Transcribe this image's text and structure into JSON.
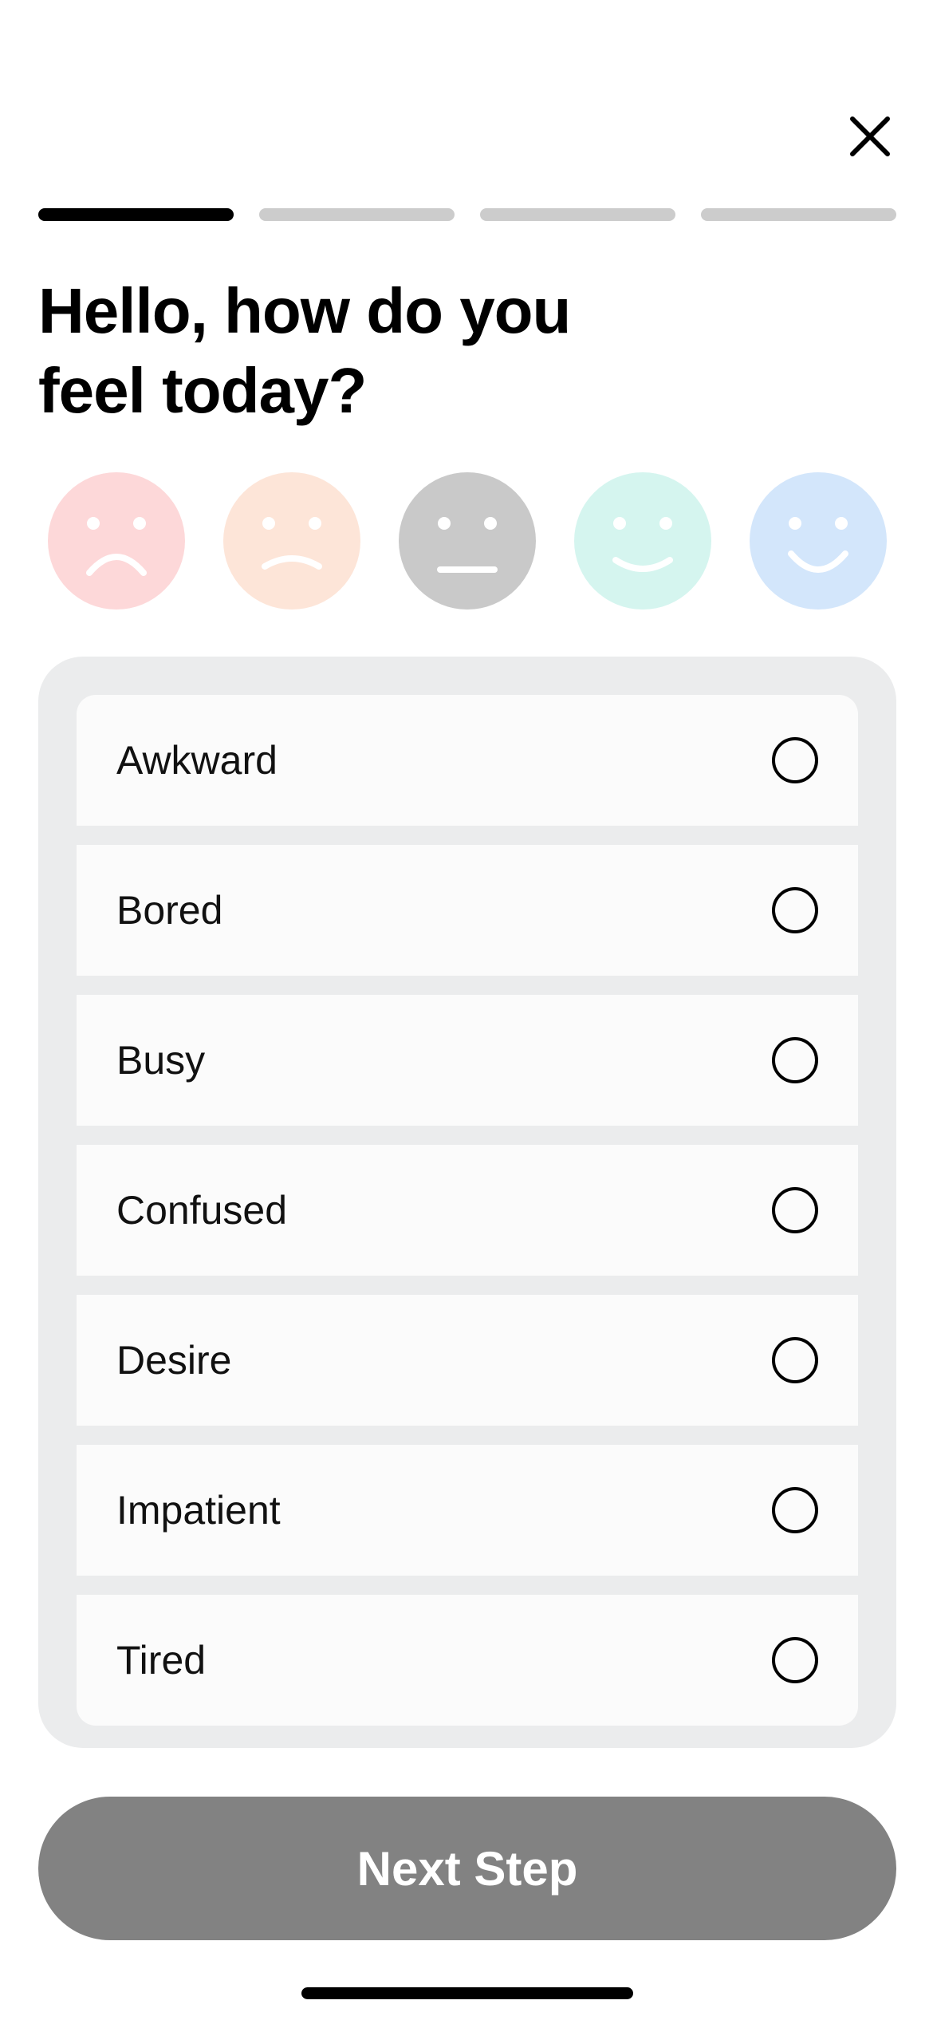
{
  "header": {
    "close_icon": "close-icon",
    "progress": {
      "total_steps": 4,
      "current_step": 1
    }
  },
  "title": "Hello, how do you feel today?",
  "moods": [
    {
      "name": "very-sad",
      "color": "#fdd8d9",
      "face_color": "#ffffff",
      "selected": false
    },
    {
      "name": "sad",
      "color": "#fde5d8",
      "face_color": "#ffffff",
      "selected": false
    },
    {
      "name": "neutral",
      "color": "#c9c9c9",
      "face_color": "#ffffff",
      "selected": true
    },
    {
      "name": "happy",
      "color": "#d5f5ef",
      "face_color": "#ffffff",
      "selected": false
    },
    {
      "name": "very-happy",
      "color": "#d3e6fb",
      "face_color": "#ffffff",
      "selected": false
    }
  ],
  "options": [
    {
      "label": "Awkward",
      "selected": false
    },
    {
      "label": "Bored",
      "selected": false
    },
    {
      "label": "Busy",
      "selected": false
    },
    {
      "label": "Confused",
      "selected": false
    },
    {
      "label": "Desire",
      "selected": false
    },
    {
      "label": "Impatient",
      "selected": false
    },
    {
      "label": "Tired",
      "selected": false
    }
  ],
  "next_button": {
    "label": "Next Step",
    "enabled": false
  },
  "colors": {
    "accent": "#000000",
    "panel_bg": "#ebeced",
    "option_bg": "#fbfbfb",
    "button_disabled": "#828282",
    "progress_inactive": "#cccccc"
  }
}
